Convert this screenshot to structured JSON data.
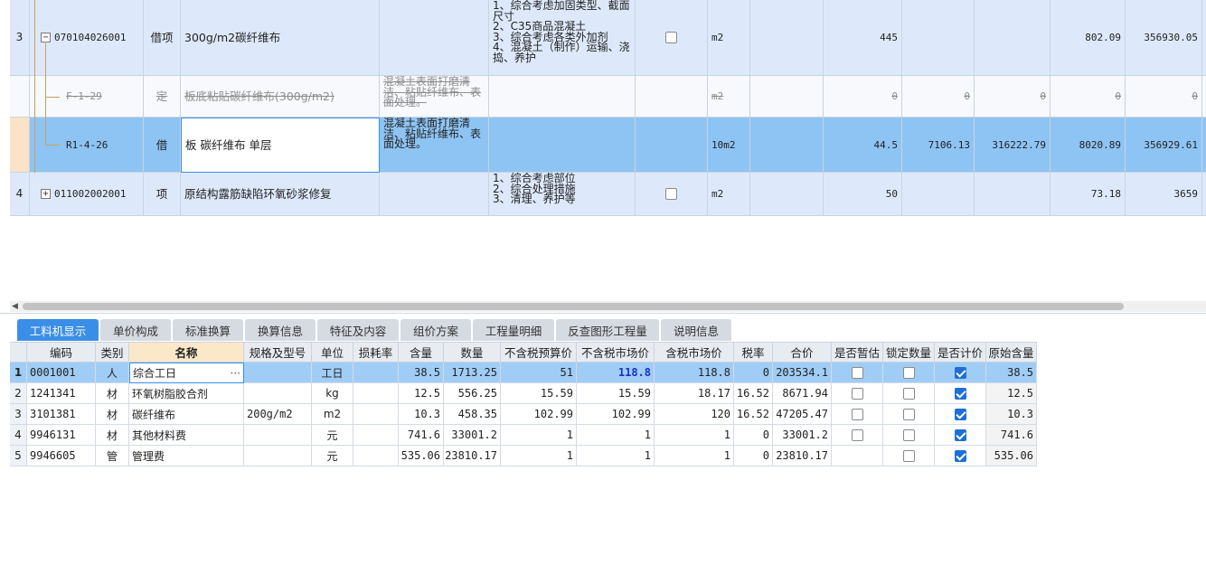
{
  "top_rows": [
    {
      "num": "3",
      "tree": "minus",
      "code": "070104026001",
      "kind": "借项",
      "name": "300g/m2碳纤维布",
      "work": "",
      "desc": "1、综合考虑加固类型、截面\n尺寸\n2、C35商品混凝土\n3、综合考虑各类外加剂\n4、混凝土（制作）运输、浇\n捣、养护",
      "check": "box",
      "unit": "m2",
      "qty": "445",
      "c1": "",
      "c2": "",
      "c3": "802.09",
      "c4": "356930.05",
      "style": "A"
    },
    {
      "num": "",
      "tree": "",
      "code": "F-1-29",
      "kind": "定",
      "name": "板底粘贴碳纤维布(300g/m2)",
      "work": "混凝土表面打磨清\n洁、粘贴纤维布、表\n面处理。",
      "desc": "",
      "check": "",
      "unit": "m2",
      "qty": "0",
      "c1": "0",
      "c2": "0",
      "c3": "0",
      "c4": "0",
      "style": "strike"
    },
    {
      "num": "",
      "tree": "",
      "code": "R1-4-26",
      "kind": "借",
      "name": "板 碳纤维布 单层",
      "work": "混凝土表面打磨清\n洁、粘贴纤维布、表\n面处理。",
      "desc": "",
      "check": "",
      "unit": "10m2",
      "qty": "44.5",
      "c1": "7106.13",
      "c2": "316222.79",
      "c3": "8020.89",
      "c4": "356929.61",
      "style": "sel"
    },
    {
      "num": "4",
      "tree": "plus",
      "code": "011002002001",
      "kind": "项",
      "name": "原结构露筋缺陷环氧砂浆修复",
      "work": "",
      "desc": "1、综合考虑部位\n2、综合处理措施\n3、清理、养护等",
      "check": "box",
      "unit": "m2",
      "qty": "50",
      "c1": "",
      "c2": "",
      "c3": "73.18",
      "c4": "3659",
      "style": "A"
    }
  ],
  "tabs": [
    "工料机显示",
    "单价构成",
    "标准换算",
    "换算信息",
    "特征及内容",
    "组价方案",
    "工程量明细",
    "反查图形工程量",
    "说明信息"
  ],
  "grid_headers": [
    "编码",
    "类别",
    "名称",
    "规格及型号",
    "单位",
    "损耗率",
    "含量",
    "数量",
    "不含税预算价",
    "不含税市场价",
    "含税市场价",
    "税率",
    "合价",
    "是否暂估",
    "锁定数量",
    "是否计价",
    "原始含量"
  ],
  "grid_rows": [
    {
      "n": "1",
      "code": "0001001",
      "cat": "人",
      "name": "综合工日",
      "spec": "",
      "unit": "工日",
      "loss": "",
      "content": "38.5",
      "qty": "1713.25",
      "budget": "51",
      "market": "118.8",
      "taxmarket": "118.8",
      "rate": "0",
      "total": "203534.1",
      "est": false,
      "lock": false,
      "priced": true,
      "orig": "38.5",
      "ellipsis": "···"
    },
    {
      "n": "2",
      "code": "1241341",
      "cat": "材",
      "name": "环氧树脂胶合剂",
      "spec": "",
      "unit": "kg",
      "loss": "",
      "content": "12.5",
      "qty": "556.25",
      "budget": "15.59",
      "market": "15.59",
      "taxmarket": "18.17",
      "rate": "16.52",
      "total": "8671.94",
      "est": false,
      "lock": false,
      "priced": true,
      "orig": "12.5",
      "ellipsis": ""
    },
    {
      "n": "3",
      "code": "3101381",
      "cat": "材",
      "name": "碳纤维布",
      "spec": "200g/m2",
      "unit": "m2",
      "loss": "",
      "content": "10.3",
      "qty": "458.35",
      "budget": "102.99",
      "market": "102.99",
      "taxmarket": "120",
      "rate": "16.52",
      "total": "47205.47",
      "est": false,
      "lock": false,
      "priced": true,
      "orig": "10.3",
      "ellipsis": ""
    },
    {
      "n": "4",
      "code": "9946131",
      "cat": "材",
      "name": "其他材料费",
      "spec": "",
      "unit": "元",
      "loss": "",
      "content": "741.6",
      "qty": "33001.2",
      "budget": "1",
      "market": "1",
      "taxmarket": "1",
      "rate": "0",
      "total": "33001.2",
      "est": false,
      "lock": false,
      "priced": true,
      "orig": "741.6",
      "ellipsis": ""
    },
    {
      "n": "5",
      "code": "9946605",
      "cat": "管",
      "name": "管理费",
      "spec": "",
      "unit": "元",
      "loss": "",
      "content": "535.06",
      "qty": "23810.17",
      "budget": "1",
      "market": "1",
      "taxmarket": "1",
      "rate": "0",
      "total": "23810.17",
      "est": null,
      "lock": false,
      "priced": true,
      "orig": "535.06",
      "ellipsis": ""
    }
  ],
  "colors": {
    "accent": "#3b8ee8",
    "selected_row": "#8ec4f3",
    "row_bg": "#dde9fb"
  }
}
